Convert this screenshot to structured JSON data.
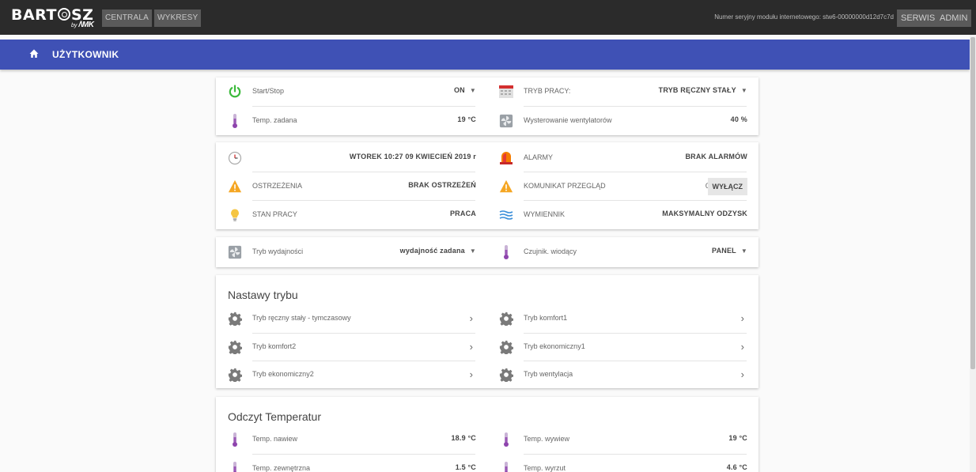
{
  "header": {
    "logo_main": "BART",
    "logo_end": "SZ",
    "logo_by": "by",
    "logo_brand": "MK",
    "nav": [
      {
        "label": "CENTRALA"
      },
      {
        "label": "WYKRESY"
      }
    ],
    "serial": "Numer seryjny modułu internetowego: stw6-00000000d12d7c7d",
    "serwis_label": "SERWIS",
    "admin_label": "ADMIN"
  },
  "subheader": {
    "title": "UŻYTKOWNIK"
  },
  "card1": {
    "start_stop": {
      "label": "Start/Stop",
      "value": "ON"
    },
    "tryb_pracy": {
      "label": "TRYB PRACY:",
      "value": "TRYB RĘCZNY STAŁY"
    },
    "temp_zadana": {
      "label": "Temp. zadana",
      "value": "19 °C"
    },
    "wentylatory": {
      "label": "Wysterowanie wentylatorów",
      "value": "40 %"
    }
  },
  "card2": {
    "datetime": "WTOREK 10:27 09 KWIECIEŃ 2019 r",
    "alarmy": {
      "label": "ALARMY",
      "value": "BRAK ALARMÓW"
    },
    "ostrzezenia": {
      "label": "OSTRZEŻENIA",
      "value": "BRAK OSTRZEŻEŃ"
    },
    "przeglad": {
      "label": "KOMUNIKAT PRZEGLĄD",
      "count": "0",
      "button": "WYŁĄCZ"
    },
    "stan_pracy": {
      "label": "STAN PRACY",
      "value": "PRACA"
    },
    "wymiennik": {
      "label": "WYMIENNIK",
      "value": "MAKSYMALNY ODZYSK"
    }
  },
  "card3": {
    "tryb_wydajnosci": {
      "label": "Tryb wydajności",
      "value": "wydajność zadana"
    },
    "czujnik": {
      "label": "Czujnik. wiodący",
      "value": "PANEL"
    }
  },
  "card4": {
    "title": "Nastawy trybu",
    "items": [
      {
        "label": "Tryb ręczny stały - tymczasowy"
      },
      {
        "label": "Tryb komfort1"
      },
      {
        "label": "Tryb komfort2"
      },
      {
        "label": "Tryb ekonomiczny1"
      },
      {
        "label": "Tryb ekonomiczny2"
      },
      {
        "label": "Tryb wentylacja"
      }
    ]
  },
  "card5": {
    "title": "Odczyt Temperatur",
    "items": [
      {
        "label": "Temp. nawiew",
        "value": "18.9 °C"
      },
      {
        "label": "Temp. wywiew",
        "value": "19 °C"
      },
      {
        "label": "Temp. zewnętrzna",
        "value": "1.5 °C"
      },
      {
        "label": "Temp. wyrzut",
        "value": "4.6 °C"
      }
    ]
  },
  "colors": {
    "blue": "#3f51b5",
    "power_green": "#3cba3c",
    "warning_orange": "#f5a623",
    "alarm_red": "#d32f2f",
    "thermo_purple": "#8e44ad"
  }
}
